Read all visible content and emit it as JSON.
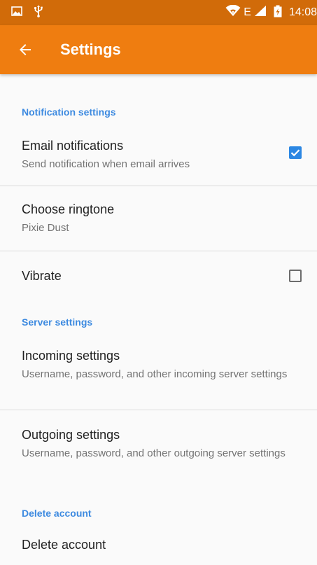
{
  "status_bar": {
    "time": "14:08",
    "network_label": "E",
    "icons": [
      "image-icon",
      "usb-icon",
      "wifi-icon",
      "signal-icon",
      "battery-icon"
    ]
  },
  "app_bar": {
    "title": "Settings",
    "back_icon": "arrow-back-icon",
    "color": "#ef7d10",
    "status_color": "#d16b09"
  },
  "notification_settings": {
    "header": "Notification settings",
    "email_notifications": {
      "title": "Email notifications",
      "summary": "Send notification when email arrives",
      "checked": true
    },
    "ringtone": {
      "title": "Choose ringtone",
      "summary": "Pixie Dust"
    },
    "vibrate": {
      "title": "Vibrate",
      "checked": false
    }
  },
  "server_settings": {
    "header": "Server settings",
    "incoming": {
      "title": "Incoming settings",
      "summary": "Username, password, and other incoming server settings"
    },
    "outgoing": {
      "title": "Outgoing settings",
      "summary": "Username, password, and other outgoing server settings"
    }
  },
  "delete_account": {
    "header": "Delete account",
    "action": {
      "title": "Delete account"
    }
  },
  "colors": {
    "accent": "#2c87e3",
    "section_header": "#3d8ae0"
  }
}
